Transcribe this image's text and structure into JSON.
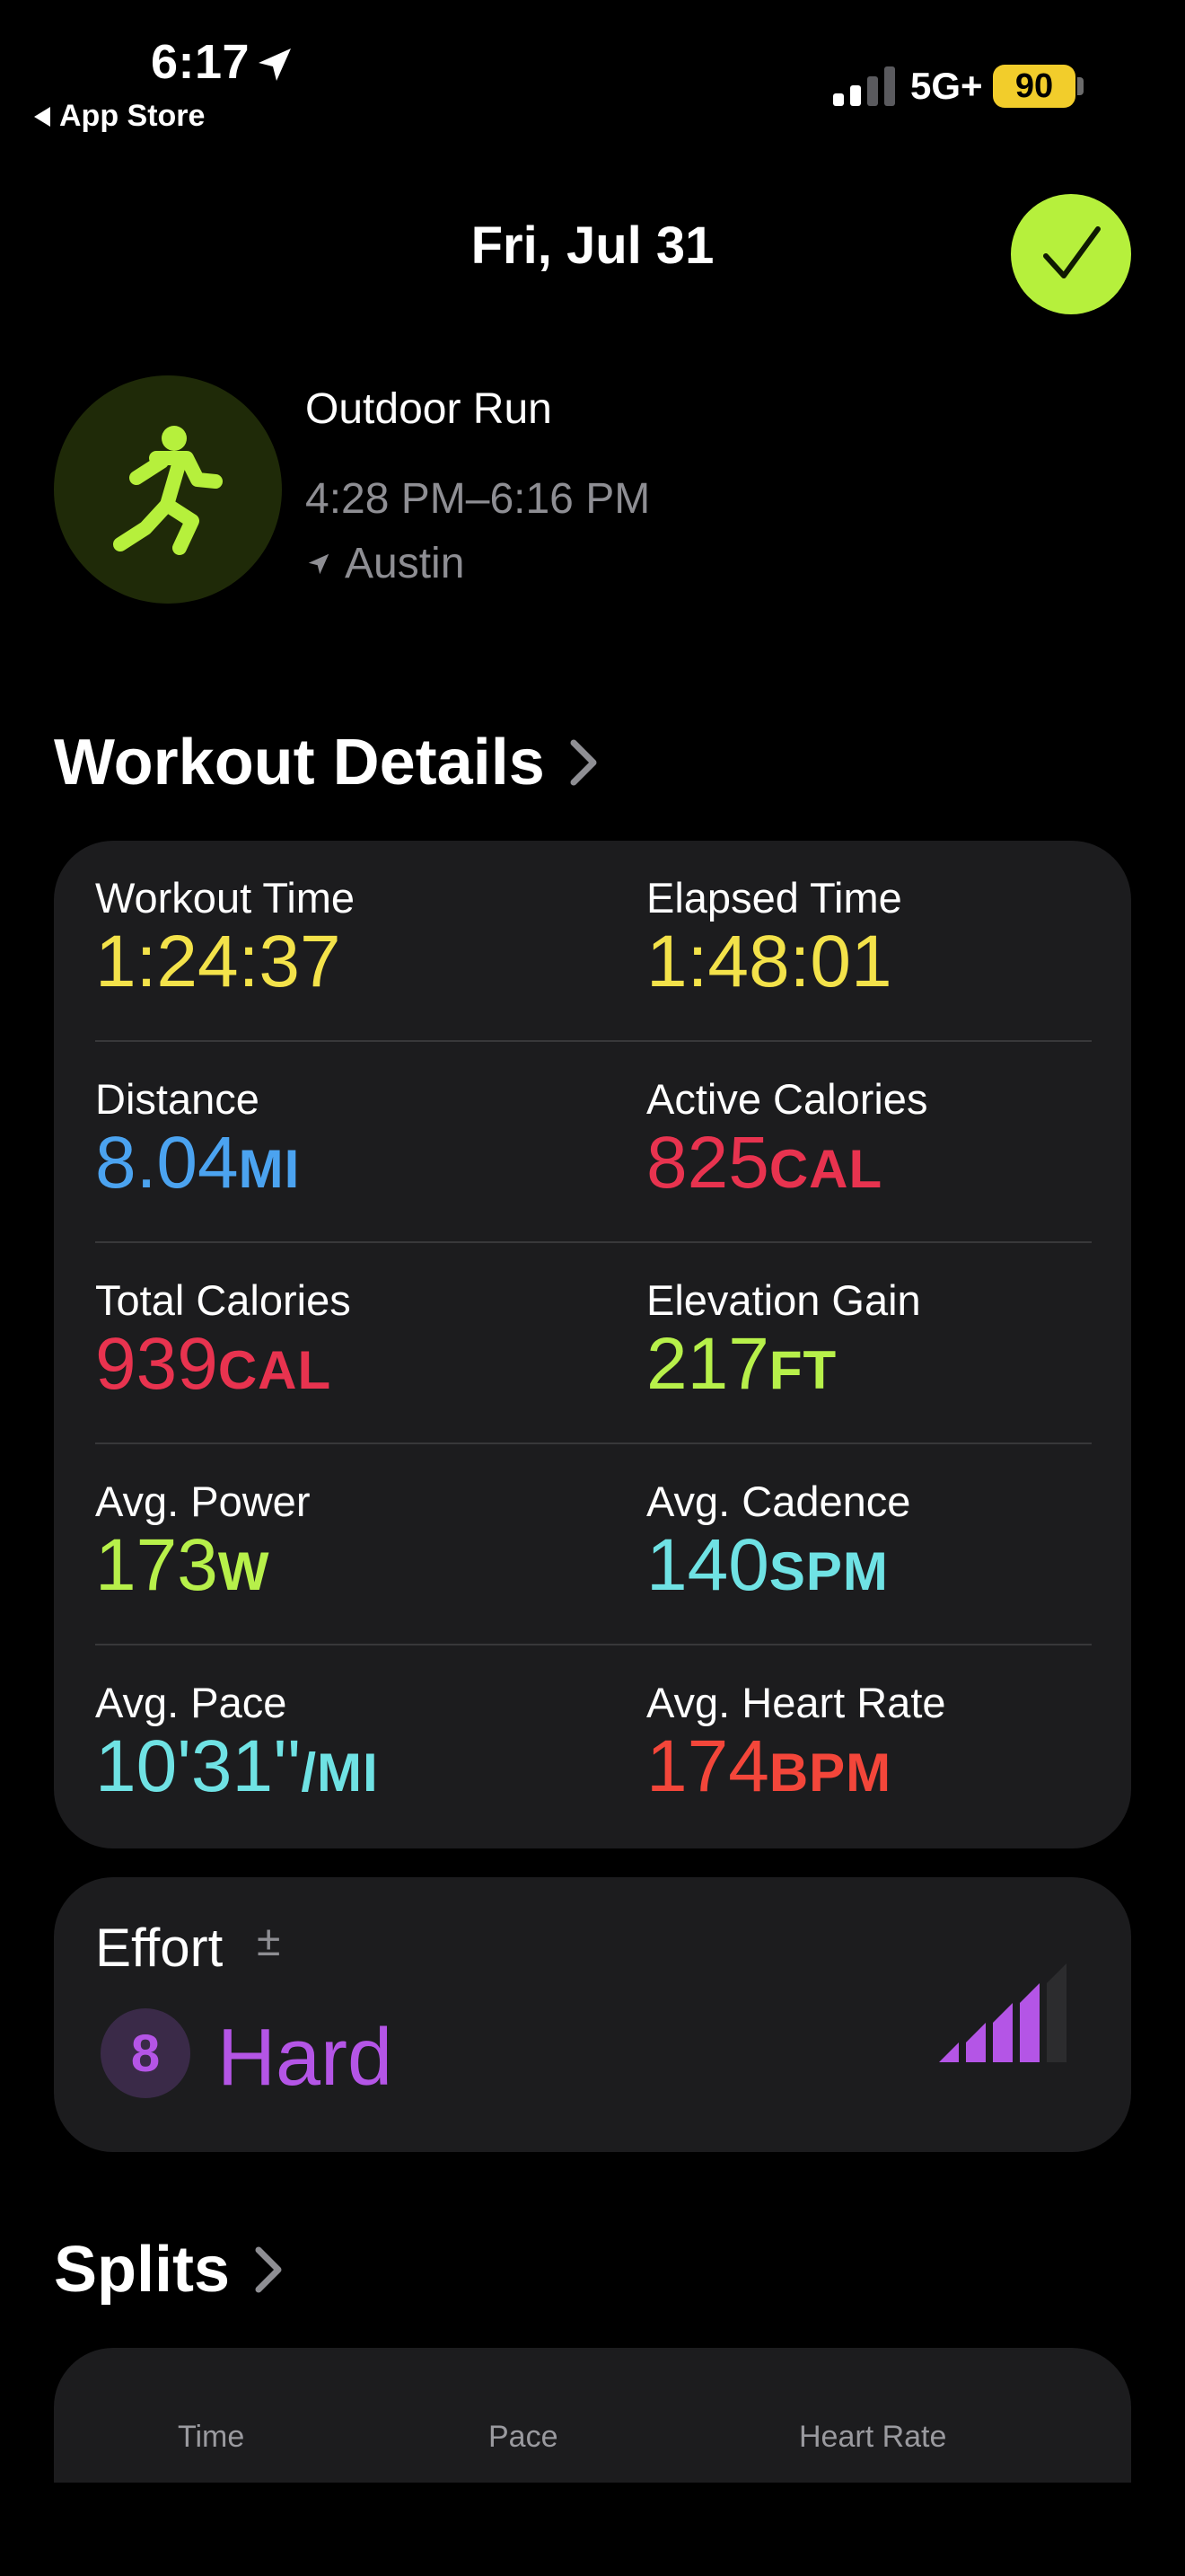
{
  "status_bar": {
    "time": "6:17",
    "back_label": "App Store",
    "network": "5G+",
    "battery": "90"
  },
  "header": {
    "date": "Fri, Jul 31"
  },
  "workout": {
    "type": "Outdoor Run",
    "time_range": "4:28 PM–6:16 PM",
    "location": "Austin",
    "icon": "figure-run-icon"
  },
  "details": {
    "title": "Workout Details",
    "metrics": [
      {
        "label": "Workout Time",
        "value": "1:24:37",
        "unit": "",
        "color": "#f3e24a"
      },
      {
        "label": "Elapsed Time",
        "value": "1:48:01",
        "unit": "",
        "color": "#f3e24a"
      },
      {
        "label": "Distance",
        "value": "8.04",
        "unit": "MI",
        "color": "#4ba3f0"
      },
      {
        "label": "Active Calories",
        "value": "825",
        "unit": "CAL",
        "color": "#e8334f"
      },
      {
        "label": "Total Calories",
        "value": "939",
        "unit": "CAL",
        "color": "#e8334f"
      },
      {
        "label": "Elevation Gain",
        "value": "217",
        "unit": "FT",
        "color": "#b7f04a"
      },
      {
        "label": "Avg. Power",
        "value": "173",
        "unit": "W",
        "color": "#b7f04a"
      },
      {
        "label": "Avg. Cadence",
        "value": "140",
        "unit": "SPM",
        "color": "#6fe2e4"
      },
      {
        "label": "Avg. Pace",
        "value": "10'31''",
        "unit": "/MI",
        "color": "#6fe2e4"
      },
      {
        "label": "Avg. Heart Rate",
        "value": "174",
        "unit": "BPM",
        "color": "#f3463a"
      }
    ]
  },
  "effort": {
    "label": "Effort",
    "adjust_symbol": "±",
    "score": "8",
    "level": "Hard",
    "bars_filled": 4,
    "bars_total": 5,
    "color": "#b455e6"
  },
  "splits": {
    "title": "Splits",
    "columns": [
      "Time",
      "Pace",
      "Heart Rate"
    ]
  },
  "colors": {
    "accent_green": "#b6f03c",
    "card_bg": "#1c1c1e",
    "secondary_text": "#8e8e93"
  }
}
